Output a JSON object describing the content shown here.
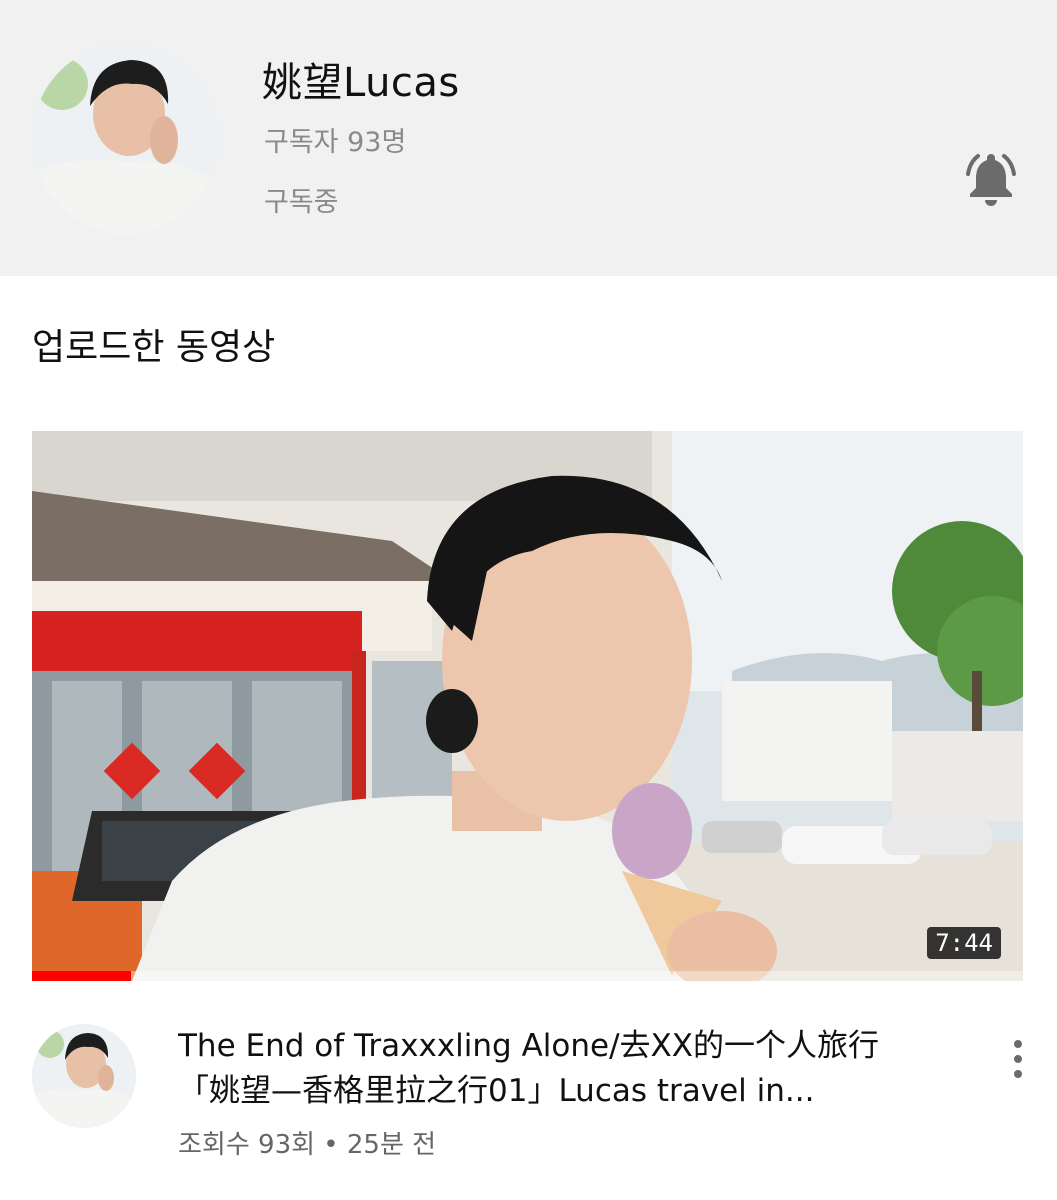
{
  "channel": {
    "name": "姚望Lucas",
    "subscribers": "구독자 93명",
    "subscription_status": "구독중"
  },
  "section": {
    "title": "업로드한 동영상"
  },
  "video": {
    "duration": "7:44",
    "watched_fraction": 0.1,
    "title": "The End of Traxxxling Alone/去XX的一个人旅行「姚望—香格里拉之行01」Lucas travel in...",
    "meta": "조회수 93회 • 25분 전"
  },
  "icons": {
    "notification": "bell-icon",
    "menu": "more-vert-icon"
  },
  "colors": {
    "header_bg": "#f1f1f1",
    "progress": "#ff0000",
    "secondary_text": "#8a8a8a"
  }
}
